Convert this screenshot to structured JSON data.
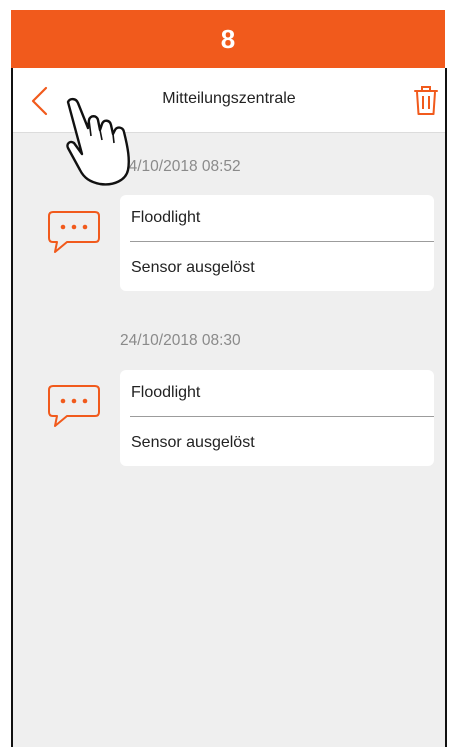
{
  "step": {
    "number": "8"
  },
  "header": {
    "title": "Mitteilungszentrale",
    "back_icon": "chevron-left-icon",
    "delete_icon": "trash-icon"
  },
  "notifications": [
    {
      "timestamp": "24/10/2018 08:52",
      "device": "Floodlight",
      "event": "Sensor ausgelöst"
    },
    {
      "timestamp": "24/10/2018 08:30",
      "device": "Floodlight",
      "event": "Sensor ausgelöst"
    }
  ],
  "colors": {
    "accent": "#f15a1c",
    "banner": "#f15a1c",
    "background": "#efefef"
  },
  "overlay": {
    "hand_icon": "tap-hand-icon"
  }
}
